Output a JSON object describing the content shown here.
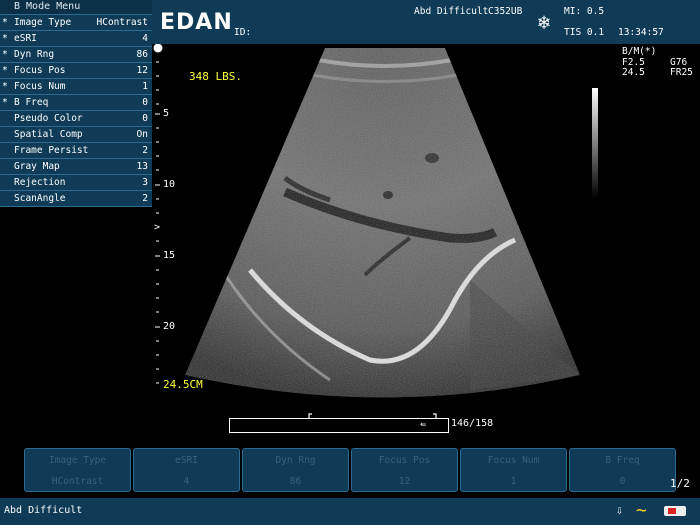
{
  "menu": {
    "title": "B Mode Menu",
    "items": [
      {
        "mark": "*",
        "label": "Image Type",
        "value": "HContrast"
      },
      {
        "mark": "*",
        "label": "eSRI",
        "value": "4"
      },
      {
        "mark": "*",
        "label": "Dyn Rng",
        "value": "86"
      },
      {
        "mark": "*",
        "label": "Focus Pos",
        "value": "12"
      },
      {
        "mark": "*",
        "label": "Focus Num",
        "value": "1"
      },
      {
        "mark": "*",
        "label": "B Freq",
        "value": "0"
      },
      {
        "mark": "",
        "label": "Pseudo Color",
        "value": "0"
      },
      {
        "mark": "",
        "label": "Spatial Comp",
        "value": "On"
      },
      {
        "mark": "",
        "label": "Frame Persist",
        "value": "2"
      },
      {
        "mark": "",
        "label": "Gray Map",
        "value": "13"
      },
      {
        "mark": "",
        "label": "Rejection",
        "value": "3"
      },
      {
        "mark": "",
        "label": "ScanAngle",
        "value": "2"
      }
    ]
  },
  "header": {
    "logo": "EDAN",
    "id_label": "ID:",
    "preset": "Abd Difficult",
    "probe": "C352UB",
    "mi": "MI: 0.5",
    "tis": "TIS 0.1",
    "time": "13:34:57",
    "freeze_icon": "snowflake-icon"
  },
  "params": {
    "mode": "B/M(*)",
    "freq": "F2.5",
    "gain": "G76",
    "depth": "24.5",
    "frame_rate": "FR25"
  },
  "image": {
    "annotation": "348 LBS.",
    "depth_marks": [
      "5",
      "10",
      "15",
      "20"
    ],
    "total_depth": "24.5CM",
    "focus_marker": ">"
  },
  "cine": {
    "frame": "146/158",
    "progress": 0.92
  },
  "softkeys": [
    {
      "title": "Image Type",
      "value": "HContrast"
    },
    {
      "title": "eSRI",
      "value": "4"
    },
    {
      "title": "Dyn Rng",
      "value": "86"
    },
    {
      "title": "Focus Pos",
      "value": "12"
    },
    {
      "title": "Focus Num",
      "value": "1"
    },
    {
      "title": "B Freq",
      "value": "0"
    }
  ],
  "page_indicator": "1/2",
  "status": {
    "preset_text": "Abd  Difficult",
    "icons": [
      "usb-icon",
      "network-wave-icon",
      "battery-icon"
    ]
  },
  "colors": {
    "panel": "#0f3b57",
    "annotation": "#ffff3a"
  }
}
